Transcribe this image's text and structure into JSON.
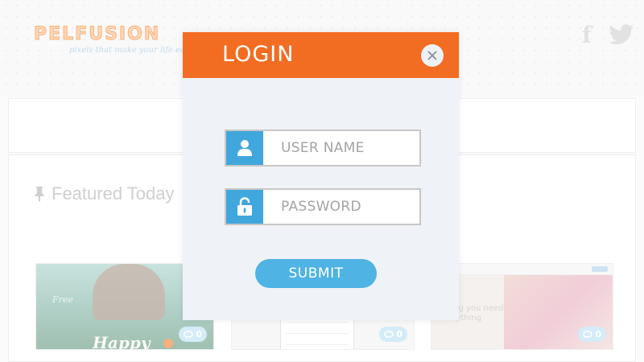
{
  "site": {
    "logo_text": "PELFUSION",
    "tagline": "pixels that make your life eas",
    "social": {
      "facebook_glyph": "f",
      "twitter_icon": "twitter-icon"
    }
  },
  "main": {
    "featured_title": "Featured Today",
    "cards": [
      {
        "comments": "0",
        "free_text": "Free",
        "happy_text": "Happy"
      },
      {
        "comments": "0"
      },
      {
        "comments": "0",
        "topbar_text": "cation",
        "hero_text_1": "hing you need",
        "hero_text_2": "anything"
      }
    ]
  },
  "modal": {
    "title": "LOGIN",
    "username": {
      "placeholder": "USER NAME",
      "value": ""
    },
    "password": {
      "placeholder": "PASSWORD",
      "value": ""
    },
    "submit_label": "SUBMIT"
  },
  "colors": {
    "header_orange": "#f26c22",
    "accent_blue": "#40a7dc",
    "submit_blue": "#4fb3e3",
    "modal_bg": "#eff2f6"
  }
}
